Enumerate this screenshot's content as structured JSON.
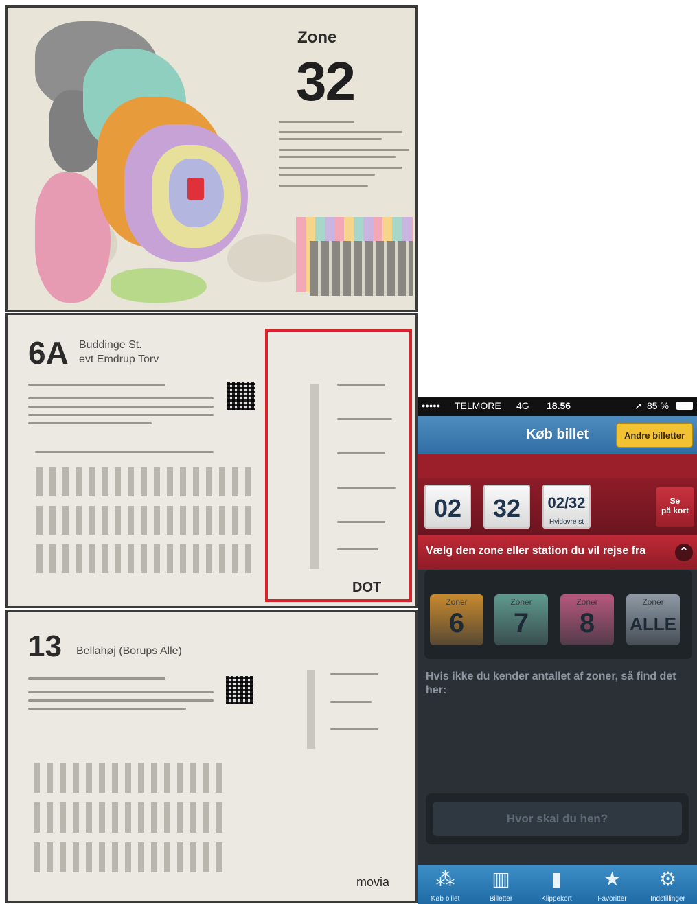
{
  "map_poster": {
    "zone_label": "Zone",
    "zone_number": "32"
  },
  "timetable_6a": {
    "route_number": "6A",
    "destination_line1": "Buddinge St.",
    "destination_line2": "evt Emdrup Torv",
    "brand": "DOT"
  },
  "timetable_13": {
    "route_number": "13",
    "destination": "Bellahøj (Borups Alle)",
    "brand": "movia"
  },
  "phone": {
    "status": {
      "signal": "●●●●●",
      "carrier": "TELMORE",
      "network": "4G",
      "time": "18.56",
      "location_arrow": "➚",
      "battery": "85 %"
    },
    "nav": {
      "title": "Køb billet",
      "other_tickets_button": "Andre billetter"
    },
    "zone_selector": {
      "tile1": "02",
      "tile2": "32",
      "tile3": "02/32",
      "tile3_sub": "Hvidovre st",
      "map_button_line1": "Se",
      "map_button_line2": "på kort"
    },
    "instruction": "Vælg den zone eller station du vil rejse fra",
    "zone_buttons": [
      {
        "label": "Zoner",
        "value": "6",
        "color": "#c98a2e"
      },
      {
        "label": "Zoner",
        "value": "7",
        "color": "#5f9a8e"
      },
      {
        "label": "Zoner",
        "value": "8",
        "color": "#b8587e"
      },
      {
        "label": "Zoner",
        "value": "ALLE",
        "color": "#8e9aa6"
      }
    ],
    "help_text": "Hvis ikke du kender antallet af zoner, så find det her:",
    "destination_placeholder": "Hvor skal du hen?",
    "tabs": [
      {
        "label": "Køb billet",
        "icon": "buy-ticket-icon"
      },
      {
        "label": "Billetter",
        "icon": "tickets-icon"
      },
      {
        "label": "Klippekort",
        "icon": "punch-card-icon"
      },
      {
        "label": "Favoritter",
        "icon": "star-icon"
      },
      {
        "label": "Indstillinger",
        "icon": "gear-icon"
      }
    ],
    "colors": {
      "nav_blue": "#3d7fb5",
      "accent_red": "#9b1f2a",
      "button_yellow": "#f2c232",
      "background_dark": "#2a3036"
    }
  }
}
